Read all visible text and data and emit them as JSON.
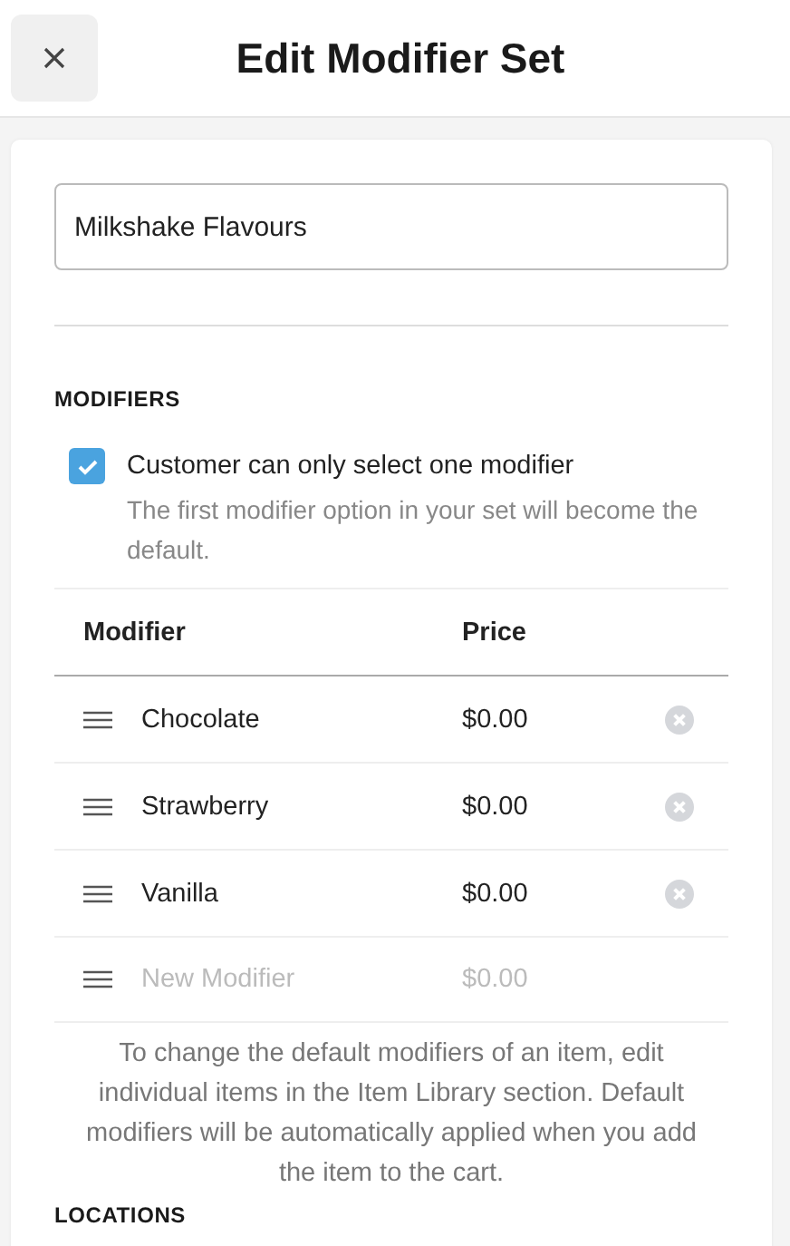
{
  "header": {
    "title": "Edit Modifier Set"
  },
  "name_field": {
    "value": "Milkshake Flavours"
  },
  "modifiers": {
    "heading": "MODIFIERS",
    "option": {
      "label": "Customer can only select one modifier",
      "hint": "The first modifier option in your set will become the default.",
      "checked": true
    },
    "columns": [
      "Modifier",
      "Price"
    ],
    "rows": [
      {
        "name": "Chocolate",
        "price": "$0.00"
      },
      {
        "name": "Strawberry",
        "price": "$0.00"
      },
      {
        "name": "Vanilla",
        "price": "$0.00"
      }
    ],
    "new_row": {
      "name": {
        "placeholder": "New Modifier"
      },
      "price": {
        "placeholder": "$0.00"
      }
    },
    "note": "To change the default modifiers of an item, edit individual items in the Item Library section. Default modifiers will be automatically applied when you add the item to the cart."
  },
  "locations": {
    "heading": "LOCATIONS"
  }
}
